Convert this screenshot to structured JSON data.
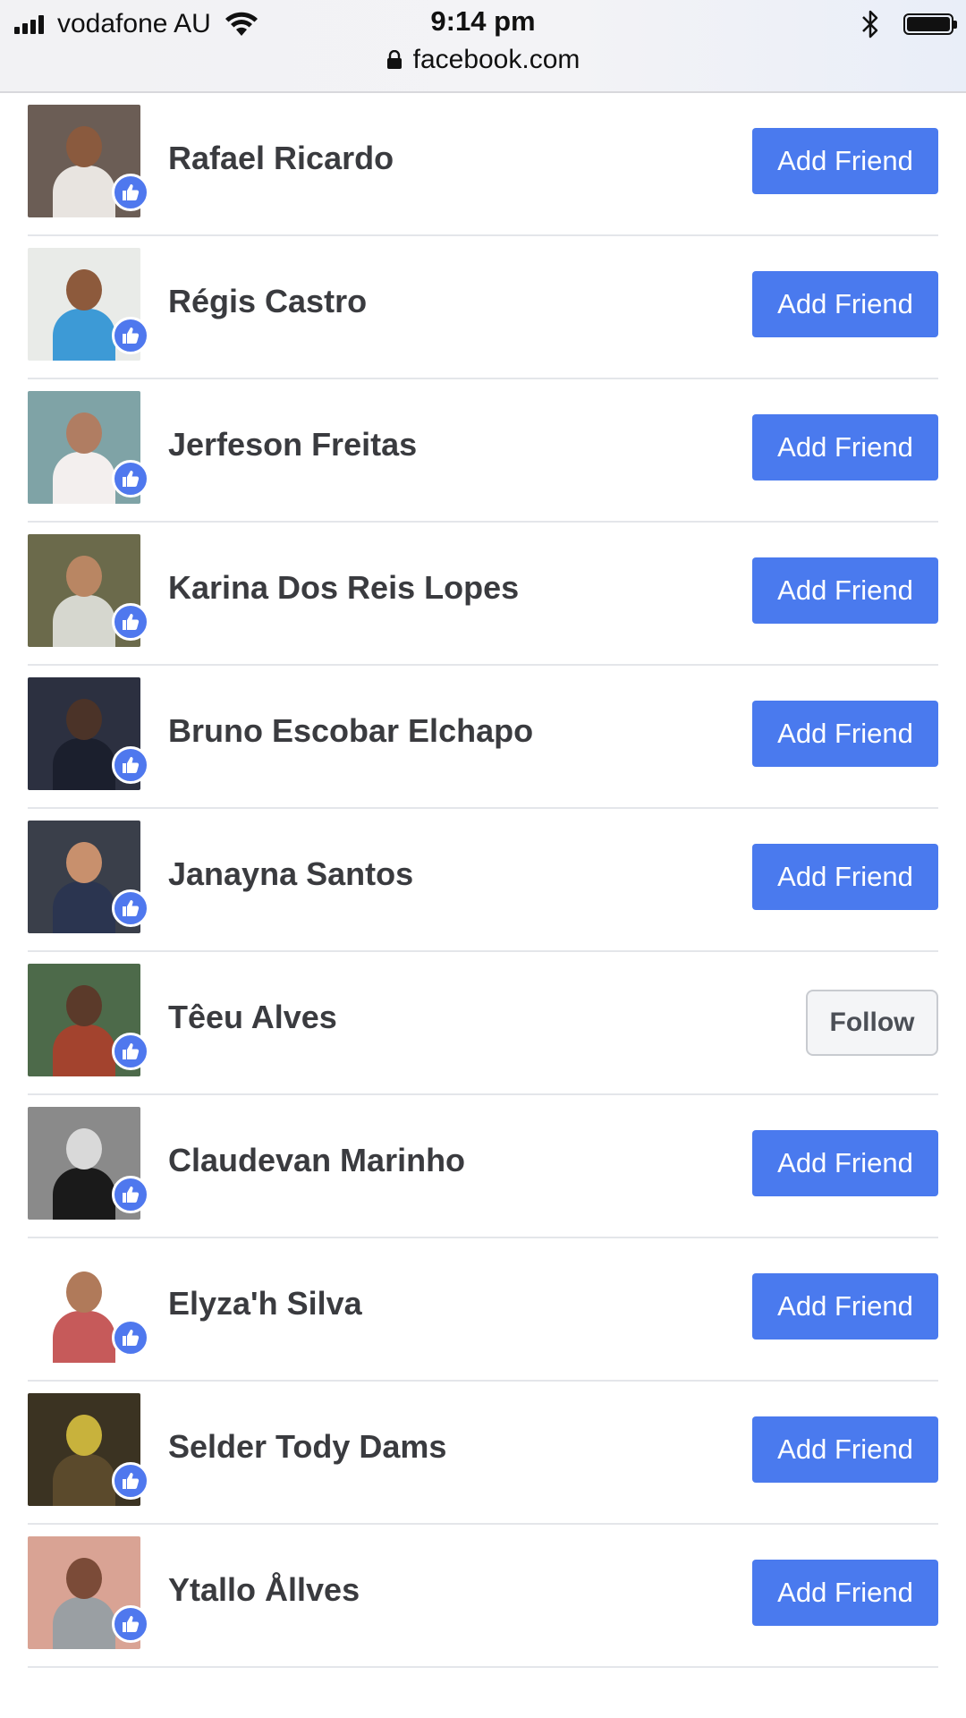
{
  "status_bar": {
    "carrier": "vodafone AU",
    "time": "9:14 pm",
    "url": "facebook.com",
    "icons": [
      "signal-icon",
      "wifi-icon",
      "bluetooth-icon",
      "battery-icon",
      "lock-icon"
    ]
  },
  "colors": {
    "accent_blue": "#4a7aee",
    "like_badge": "#4f78ee",
    "name_text": "#3a3b3f",
    "divider": "#e4e6ea"
  },
  "people": [
    {
      "name": "Rafael Ricardo",
      "action": "Add Friend",
      "action_type": "add"
    },
    {
      "name": "Régis Castro",
      "action": "Add Friend",
      "action_type": "add"
    },
    {
      "name": "Jerfeson Freitas",
      "action": "Add Friend",
      "action_type": "add"
    },
    {
      "name": "Karina Dos Reis Lopes",
      "action": "Add Friend",
      "action_type": "add"
    },
    {
      "name": "Bruno Escobar Elchapo",
      "action": "Add Friend",
      "action_type": "add"
    },
    {
      "name": "Janayna Santos",
      "action": "Add Friend",
      "action_type": "add"
    },
    {
      "name": "Têeu Alves",
      "action": "Follow",
      "action_type": "follow"
    },
    {
      "name": "Claudevan Marinho",
      "action": "Add Friend",
      "action_type": "add"
    },
    {
      "name": "Elyza'h Silva",
      "action": "Add Friend",
      "action_type": "add"
    },
    {
      "name": "Selder Tody Dams",
      "action": "Add Friend",
      "action_type": "add"
    },
    {
      "name": "Ytallo Ållves",
      "action": "Add Friend",
      "action_type": "add"
    }
  ],
  "avatar_palettes": [
    {
      "bg": "#6b5d55",
      "skin": "#8a5a3e",
      "shirt": "#e8e4e0"
    },
    {
      "bg": "#e9ebe8",
      "skin": "#8d5a3c",
      "shirt": "#3d9ad6"
    },
    {
      "bg": "#7fa3a6",
      "skin": "#b07d62",
      "shirt": "#f3efee"
    },
    {
      "bg": "#6b6a4b",
      "skin": "#b98663",
      "shirt": "#d6d7cf"
    },
    {
      "bg": "#2c3040",
      "skin": "#4b3328",
      "shirt": "#1b1f2d"
    },
    {
      "bg": "#3a3f4a",
      "skin": "#c8906d",
      "shirt": "#2b3550"
    },
    {
      "bg": "#4d6a4a",
      "skin": "#5b3a2a",
      "shirt": "#a3432e"
    },
    {
      "bg": "#8a8a8a",
      "skin": "#d9d9d9",
      "shirt": "#1a1a1a"
    },
    {
      "bg": "#ffffff",
      "skin": "#b07a5a",
      "shirt": "#c65a5a"
    },
    {
      "bg": "#3b3322",
      "skin": "#c8b23c",
      "shirt": "#5b4a2c"
    },
    {
      "bg": "#d9a394",
      "skin": "#7b4b38",
      "shirt": "#9a9fa3"
    }
  ]
}
